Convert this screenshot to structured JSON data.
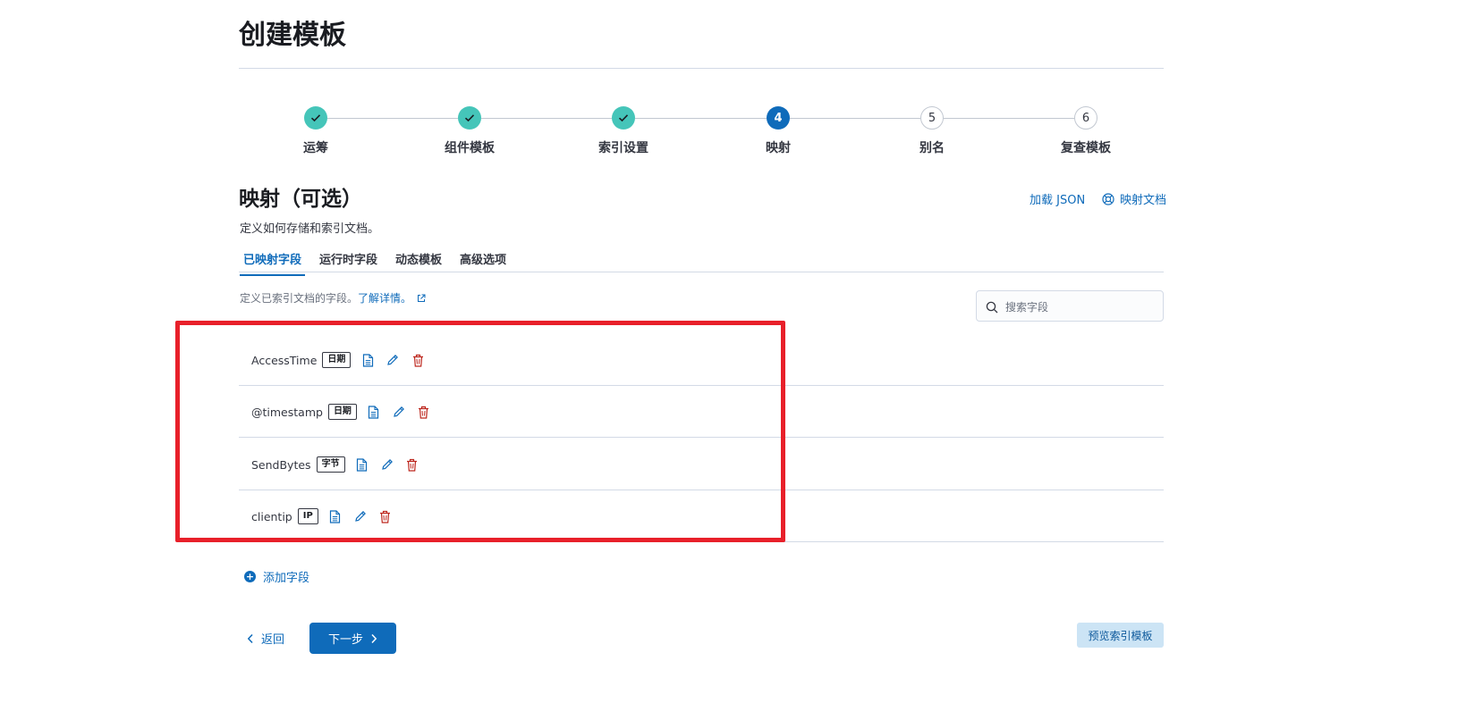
{
  "page": {
    "title": "创建模板"
  },
  "steps": [
    {
      "label": "运筹",
      "status": "complete",
      "marker": ""
    },
    {
      "label": "组件模板",
      "status": "complete",
      "marker": ""
    },
    {
      "label": "索引设置",
      "status": "complete",
      "marker": ""
    },
    {
      "label": "映射",
      "status": "current",
      "marker": "4"
    },
    {
      "label": "别名",
      "status": "incomplete",
      "marker": "5"
    },
    {
      "label": "复查模板",
      "status": "incomplete",
      "marker": "6"
    }
  ],
  "section": {
    "title": "映射（可选）",
    "description": "定义如何存储和索引文档。",
    "load_json": "加载 JSON",
    "docs_link": "映射文档"
  },
  "tabs": [
    {
      "label": "已映射字段",
      "active": true
    },
    {
      "label": "运行时字段",
      "active": false
    },
    {
      "label": "动态模板",
      "active": false
    },
    {
      "label": "高级选项",
      "active": false
    }
  ],
  "fields_section": {
    "description": "定义已索引文档的字段。",
    "learn_more": "了解详情。",
    "search_placeholder": "搜索字段"
  },
  "fields": [
    {
      "name": "AccessTime",
      "type": "日期"
    },
    {
      "name": "@timestamp",
      "type": "日期"
    },
    {
      "name": "SendBytes",
      "type": "字节"
    },
    {
      "name": "clientip",
      "type": "IP"
    }
  ],
  "actions": {
    "add_field": "添加字段",
    "back": "返回",
    "next": "下一步",
    "preview": "预览索引模板"
  },
  "colors": {
    "primary": "#0f6bba",
    "complete": "#45c5b9",
    "danger": "#bd271e",
    "highlight": "#e8202a"
  }
}
